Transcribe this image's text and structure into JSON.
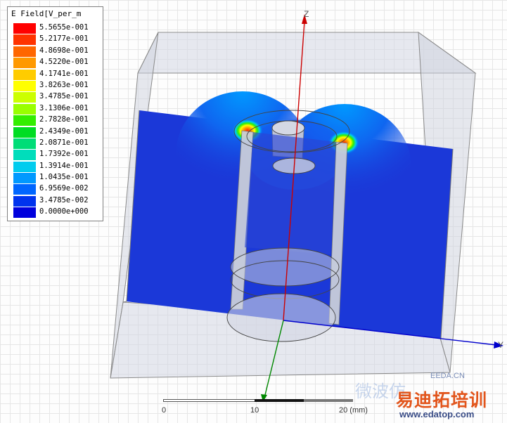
{
  "legend": {
    "title": "E Field[V_per_m",
    "entries": [
      {
        "value": "5.5655e-001",
        "color": "#ff0000"
      },
      {
        "value": "5.2177e-001",
        "color": "#ff3300"
      },
      {
        "value": "4.8698e-001",
        "color": "#ff6600"
      },
      {
        "value": "4.5220e-001",
        "color": "#ff9900"
      },
      {
        "value": "4.1741e-001",
        "color": "#ffcc00"
      },
      {
        "value": "3.8263e-001",
        "color": "#ffff00"
      },
      {
        "value": "3.4785e-001",
        "color": "#ccff00"
      },
      {
        "value": "3.1306e-001",
        "color": "#99ff00"
      },
      {
        "value": "2.7828e-001",
        "color": "#33ee00"
      },
      {
        "value": "2.4349e-001",
        "color": "#00dd22"
      },
      {
        "value": "2.0871e-001",
        "color": "#00dd77"
      },
      {
        "value": "1.7392e-001",
        "color": "#00ddbb"
      },
      {
        "value": "1.3914e-001",
        "color": "#00ccee"
      },
      {
        "value": "1.0435e-001",
        "color": "#0099ff"
      },
      {
        "value": "6.9569e-002",
        "color": "#0066ff"
      },
      {
        "value": "3.4785e-002",
        "color": "#0033ee"
      },
      {
        "value": "0.0000e+000",
        "color": "#0000dd"
      }
    ]
  },
  "axes": {
    "z_label": "Z",
    "y_label": "Y",
    "z_color": "#cc0000",
    "y_color": "#0000cc",
    "x_color": "#008800"
  },
  "scale_bar": {
    "label_0": "0",
    "label_10": "10",
    "label_20": "20 (mm)"
  },
  "watermark": {
    "site": "EEDA.CN",
    "brand": "易迪拓培训",
    "url": "www.edatop.com",
    "faint_text": "微波仿"
  },
  "colors": {
    "field_low": "#1b38d8",
    "box_fill": "#c9cede"
  }
}
